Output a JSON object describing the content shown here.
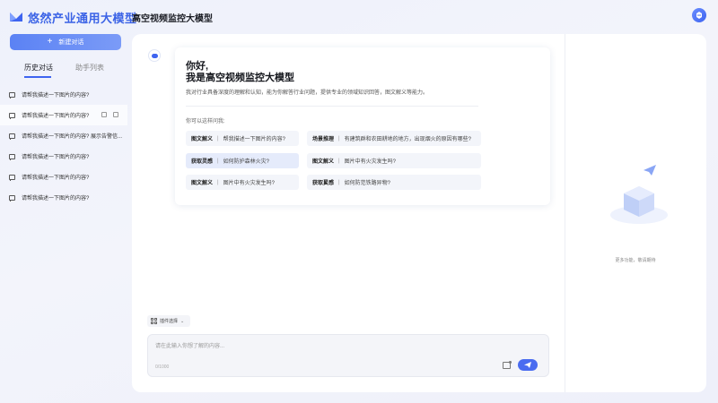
{
  "brand": {
    "name": "悠然产业通用大模型"
  },
  "header": {
    "title": "高空视频监控大模型"
  },
  "sidebar": {
    "new_chat_label": "新建对话",
    "tabs": [
      {
        "label": "历史对话",
        "active": true
      },
      {
        "label": "助手列表",
        "active": false
      }
    ],
    "history": [
      {
        "text": "请帮我描述一下图片的内容?"
      },
      {
        "text": "请帮我描述一下图片的内容?",
        "active": true
      },
      {
        "text": "请帮我描述一下图片的内容? 展示告警信..."
      },
      {
        "text": "请帮我描述一下图片的内容?"
      },
      {
        "text": "请帮我描述一下图片的内容?"
      },
      {
        "text": "请帮我描述一下图片的内容?"
      }
    ]
  },
  "welcome": {
    "greeting_line1": "你好,",
    "greeting_line2": "我是高空视频监控大模型",
    "intro": "我对行业具备深度的理解和认知，能为你解答行业问题，提供专业的领域知识回答，图文解义等能力。",
    "ask_label": "你可以这样问我:",
    "suggestions": [
      {
        "tag": "图文解义",
        "text": "帮我描述一下图片的内容?"
      },
      {
        "tag": "场景推理",
        "text": "有建筑群和农田耕地的地方，出现烟火的原因有哪些?"
      },
      {
        "tag": "获取灵感",
        "text": "如何防护森林火灾?"
      },
      {
        "tag": "图文解义",
        "text": "图片中有火灾发生吗?"
      },
      {
        "tag": "图文解义",
        "text": "图片中有火灾发生吗?"
      },
      {
        "tag": "获取灵感",
        "text": "如何防范铁路异物?"
      }
    ]
  },
  "composer": {
    "mode_label": "插件选择",
    "placeholder": "请在此输入你想了解的内容...",
    "count": "0/1000"
  },
  "right_panel": {
    "empty_text": "更多功能，敬请期待"
  },
  "colors": {
    "accent": "#3e64f0",
    "brand": "#3b63e6"
  }
}
